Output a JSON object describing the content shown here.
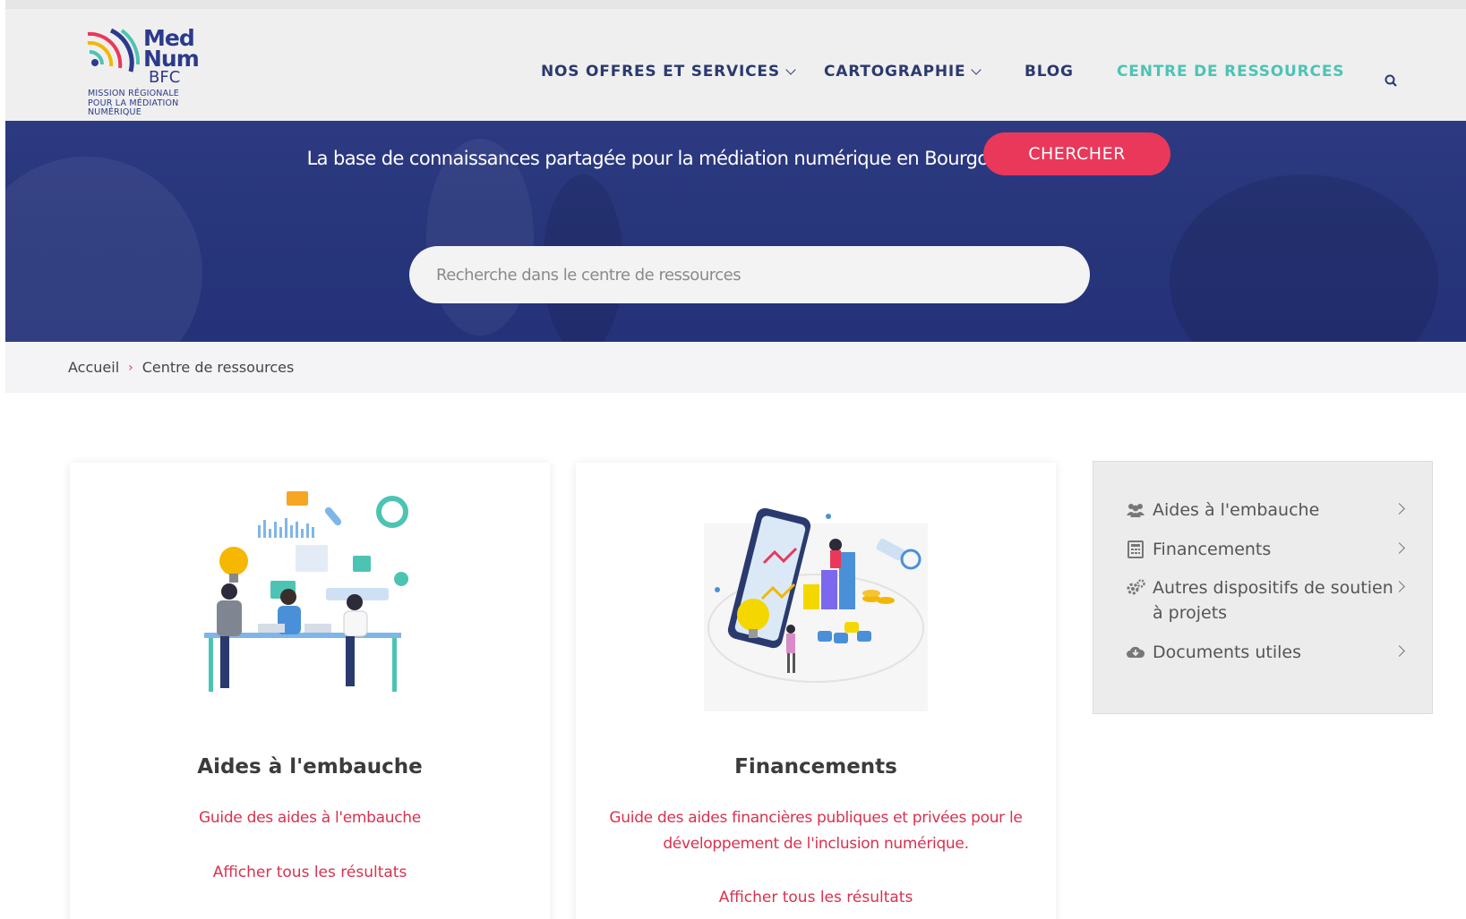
{
  "logo": {
    "word1": "Med",
    "word2": "Num",
    "word3": "BFC",
    "tagline": "MISSION RÉGIONALE\nPOUR LA MÉDIATION\nNUMÉRIQUE",
    "colors": [
      "#e9385a",
      "#f2b705",
      "#4dc3b4",
      "#2b3a8c"
    ]
  },
  "nav": {
    "items": [
      {
        "label": "NOS OFFRES ET SERVICES",
        "has_dropdown": true
      },
      {
        "label": "CARTOGRAPHIE",
        "has_dropdown": true
      },
      {
        "label": "BLOG",
        "has_dropdown": false
      },
      {
        "label": "CENTRE DE RESSOURCES",
        "active": true
      }
    ],
    "search_icon": "search-icon",
    "active_color": "#4dc3b4",
    "text_color": "#2b3a6e"
  },
  "hero": {
    "title": "La base de connaissances partagée pour la médiation numérique en Bourgogne-Franche-Comté",
    "search_placeholder": "Recherche dans le centre de ressources",
    "search_button": "CHERCHER",
    "background": "#2a3780",
    "button_color": "#e9385a"
  },
  "breadcrumb": {
    "items": [
      "Accueil",
      "Centre de ressources"
    ],
    "separator": "›"
  },
  "cards": [
    {
      "title": "Aides à l'embauche",
      "description": "Guide des aides à l'embauche",
      "more": "Afficher tous les résultats",
      "illustration": "team-meeting-illustration"
    },
    {
      "title": "Financements",
      "description": "Guide des aides financières publiques et privées pour le développement de l'inclusion numérique.",
      "more": "Afficher tous les résultats",
      "illustration": "finance-phone-illustration"
    }
  ],
  "side_menu": {
    "items": [
      {
        "label": "Aides à l'embauche",
        "icon": "users-icon"
      },
      {
        "label": "Financements",
        "icon": "calculator-icon"
      },
      {
        "label": "Autres dispositifs de soutien à projets",
        "icon": "gears-icon"
      },
      {
        "label": "Documents utiles",
        "icon": "cloud-download-icon"
      }
    ]
  }
}
